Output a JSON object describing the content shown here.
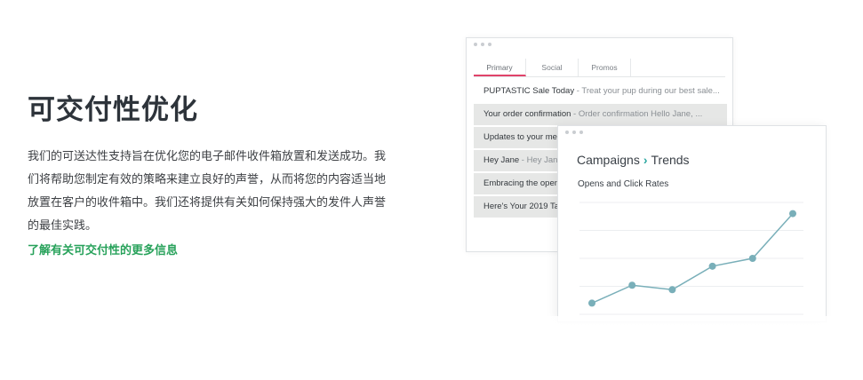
{
  "section": {
    "title": "可交付性优化",
    "description": "我们的可送达性支持旨在优化您的电子邮件收件箱放置和发送成功。我们将帮助您制定有效的策略来建立良好的声誉，从而将您的内容适当地放置在客户的收件箱中。我们还将提供有关如何保持强大的发件人声誉的最佳实践。",
    "learn_more": "了解有关可交付性的更多信息"
  },
  "inbox": {
    "tabs": [
      {
        "label": "Primary"
      },
      {
        "label": "Social"
      },
      {
        "label": "Promos"
      }
    ],
    "emails": [
      {
        "subject": "PUPTASTIC Sale Today",
        "preview": " - Treat your pup during our best sale..."
      },
      {
        "subject": "Your order confirmation",
        "preview": " - Order confirmation Hello Jane, ..."
      },
      {
        "subject": "Updates to your me",
        "preview": ""
      },
      {
        "subject": "Hey Jane",
        "preview": " - Hey Jane"
      },
      {
        "subject": "Embracing the open",
        "preview": ""
      },
      {
        "subject": "Here's Your 2019 Ta",
        "preview": ""
      }
    ]
  },
  "campaigns": {
    "breadcrumb_root": "Campaigns",
    "breadcrumb_sep": "›",
    "breadcrumb_current": "Trends",
    "chart_title": "Opens and Click Rates"
  },
  "chart_data": {
    "type": "line",
    "title": "Opens and Click Rates",
    "x": [
      1,
      2,
      3,
      4,
      5,
      6
    ],
    "series": [
      {
        "values": [
          1.0,
          2.6,
          2.2,
          4.3,
          5.0,
          9.0
        ]
      }
    ],
    "ylim": [
      0,
      10
    ],
    "grid": true,
    "color": "#79afb9"
  },
  "colors": {
    "accent_green": "#28a25b",
    "tab_active": "#e0436a",
    "breadcrumb_chevron": "#2aa7a0",
    "series_line": "#79afb9"
  }
}
